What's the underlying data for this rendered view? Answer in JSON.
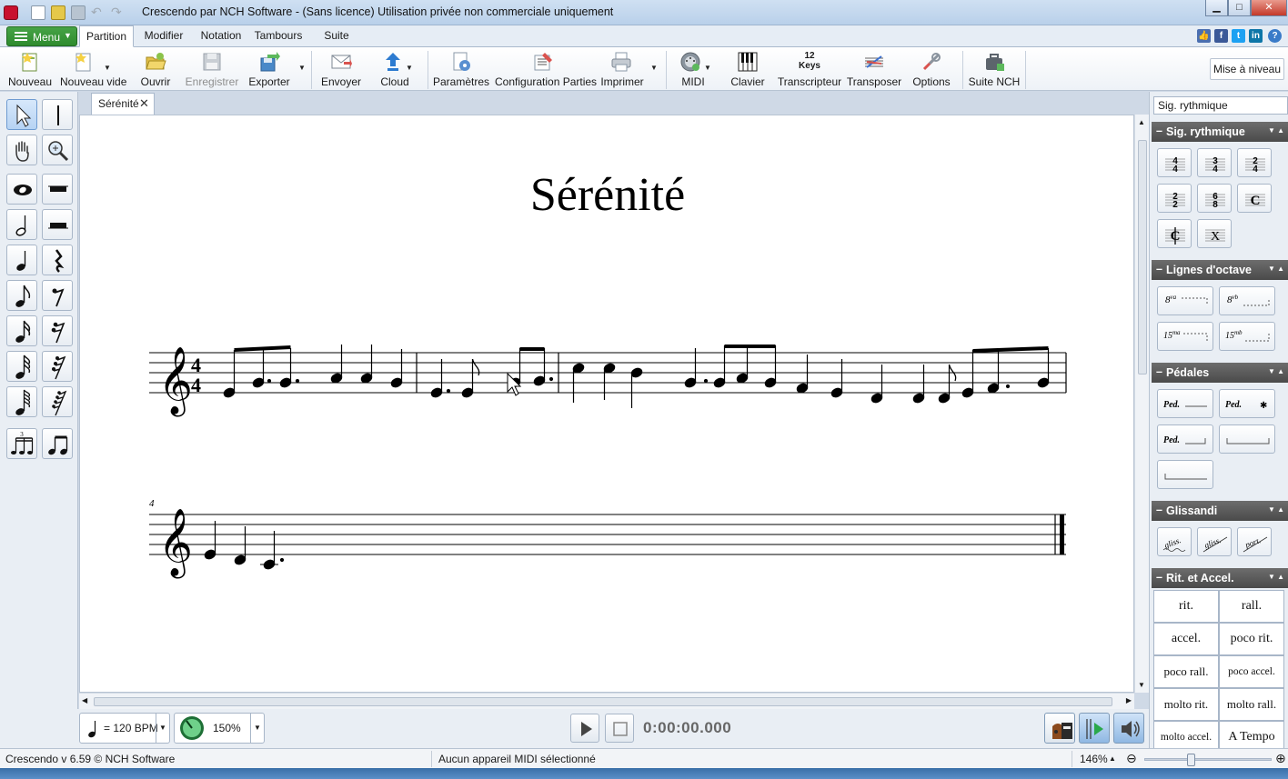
{
  "window": {
    "title": "Crescendo par NCH Software - (Sans licence) Utilisation privée non commerciale uniquement"
  },
  "ribbon": {
    "menu_label": "Menu",
    "tabs": [
      "Partition",
      "Modifier",
      "Notation",
      "Tambours",
      "Suite"
    ],
    "active_tab": "Partition"
  },
  "toolbar": {
    "buttons": [
      {
        "label": "Nouveau",
        "icon": "new-file-icon"
      },
      {
        "label": "Nouveau vide",
        "icon": "new-blank-icon"
      },
      {
        "label": "Ouvrir",
        "icon": "open-folder-icon"
      },
      {
        "label": "Enregistrer",
        "icon": "save-icon",
        "disabled": true
      },
      {
        "label": "Exporter",
        "icon": "export-icon"
      },
      {
        "label": "Envoyer",
        "icon": "email-icon"
      },
      {
        "label": "Cloud",
        "icon": "cloud-upload-icon"
      },
      {
        "label": "Paramètres",
        "icon": "settings-doc-icon"
      },
      {
        "label": "Configuration Parties",
        "icon": "parts-config-icon"
      },
      {
        "label": "Imprimer",
        "icon": "printer-icon"
      },
      {
        "label": "MIDI",
        "icon": "midi-icon"
      },
      {
        "label": "Clavier",
        "icon": "keyboard-icon"
      },
      {
        "label": "Transcripteur",
        "icon": "transcriber-icon",
        "icon_text": "12 Keys"
      },
      {
        "label": "Transposer",
        "icon": "transpose-icon"
      },
      {
        "label": "Options",
        "icon": "tools-icon"
      },
      {
        "label": "Suite NCH",
        "icon": "nch-suite-icon"
      }
    ],
    "upgrade_label": "Mise à niveau"
  },
  "document": {
    "tab_label": "Sérénité",
    "score_title": "Sérénité",
    "time_signature": "4/4",
    "measure_number_system2": "4"
  },
  "right_panel": {
    "dropdown_value": "Sig. rythmique",
    "sections": {
      "time_sig": "Sig. rythmique",
      "octave": "Lignes d'octave",
      "pedals": "Pédales",
      "gliss": "Glissandi",
      "rit": "Rit. et Accel."
    },
    "time_sig_buttons": [
      "4/4",
      "3/4",
      "2/4",
      "2/2",
      "6/8",
      "C",
      "¢",
      "X"
    ],
    "octave_buttons": [
      "8va",
      "8vb",
      "15ma",
      "15mb"
    ],
    "gliss_buttons": [
      "gliss.",
      "gliss.",
      "port."
    ],
    "rit_cells": [
      "rit.",
      "rall.",
      "accel.",
      "poco rit.",
      "poco rall.",
      "poco accel.",
      "molto rit.",
      "molto rall.",
      "molto accel.",
      "A Tempo"
    ]
  },
  "transport": {
    "tempo": "= 120 BPM",
    "zoom_play": "150%",
    "time": "0:00:00.000"
  },
  "status": {
    "version": "Crescendo v 6.59 © NCH Software",
    "midi": "Aucun appareil MIDI sélectionné",
    "zoom": "146%"
  },
  "colors": {
    "menu_green": "#2e8b2e",
    "panel_header": "#555555",
    "accent_blue": "#6e9bd1"
  }
}
